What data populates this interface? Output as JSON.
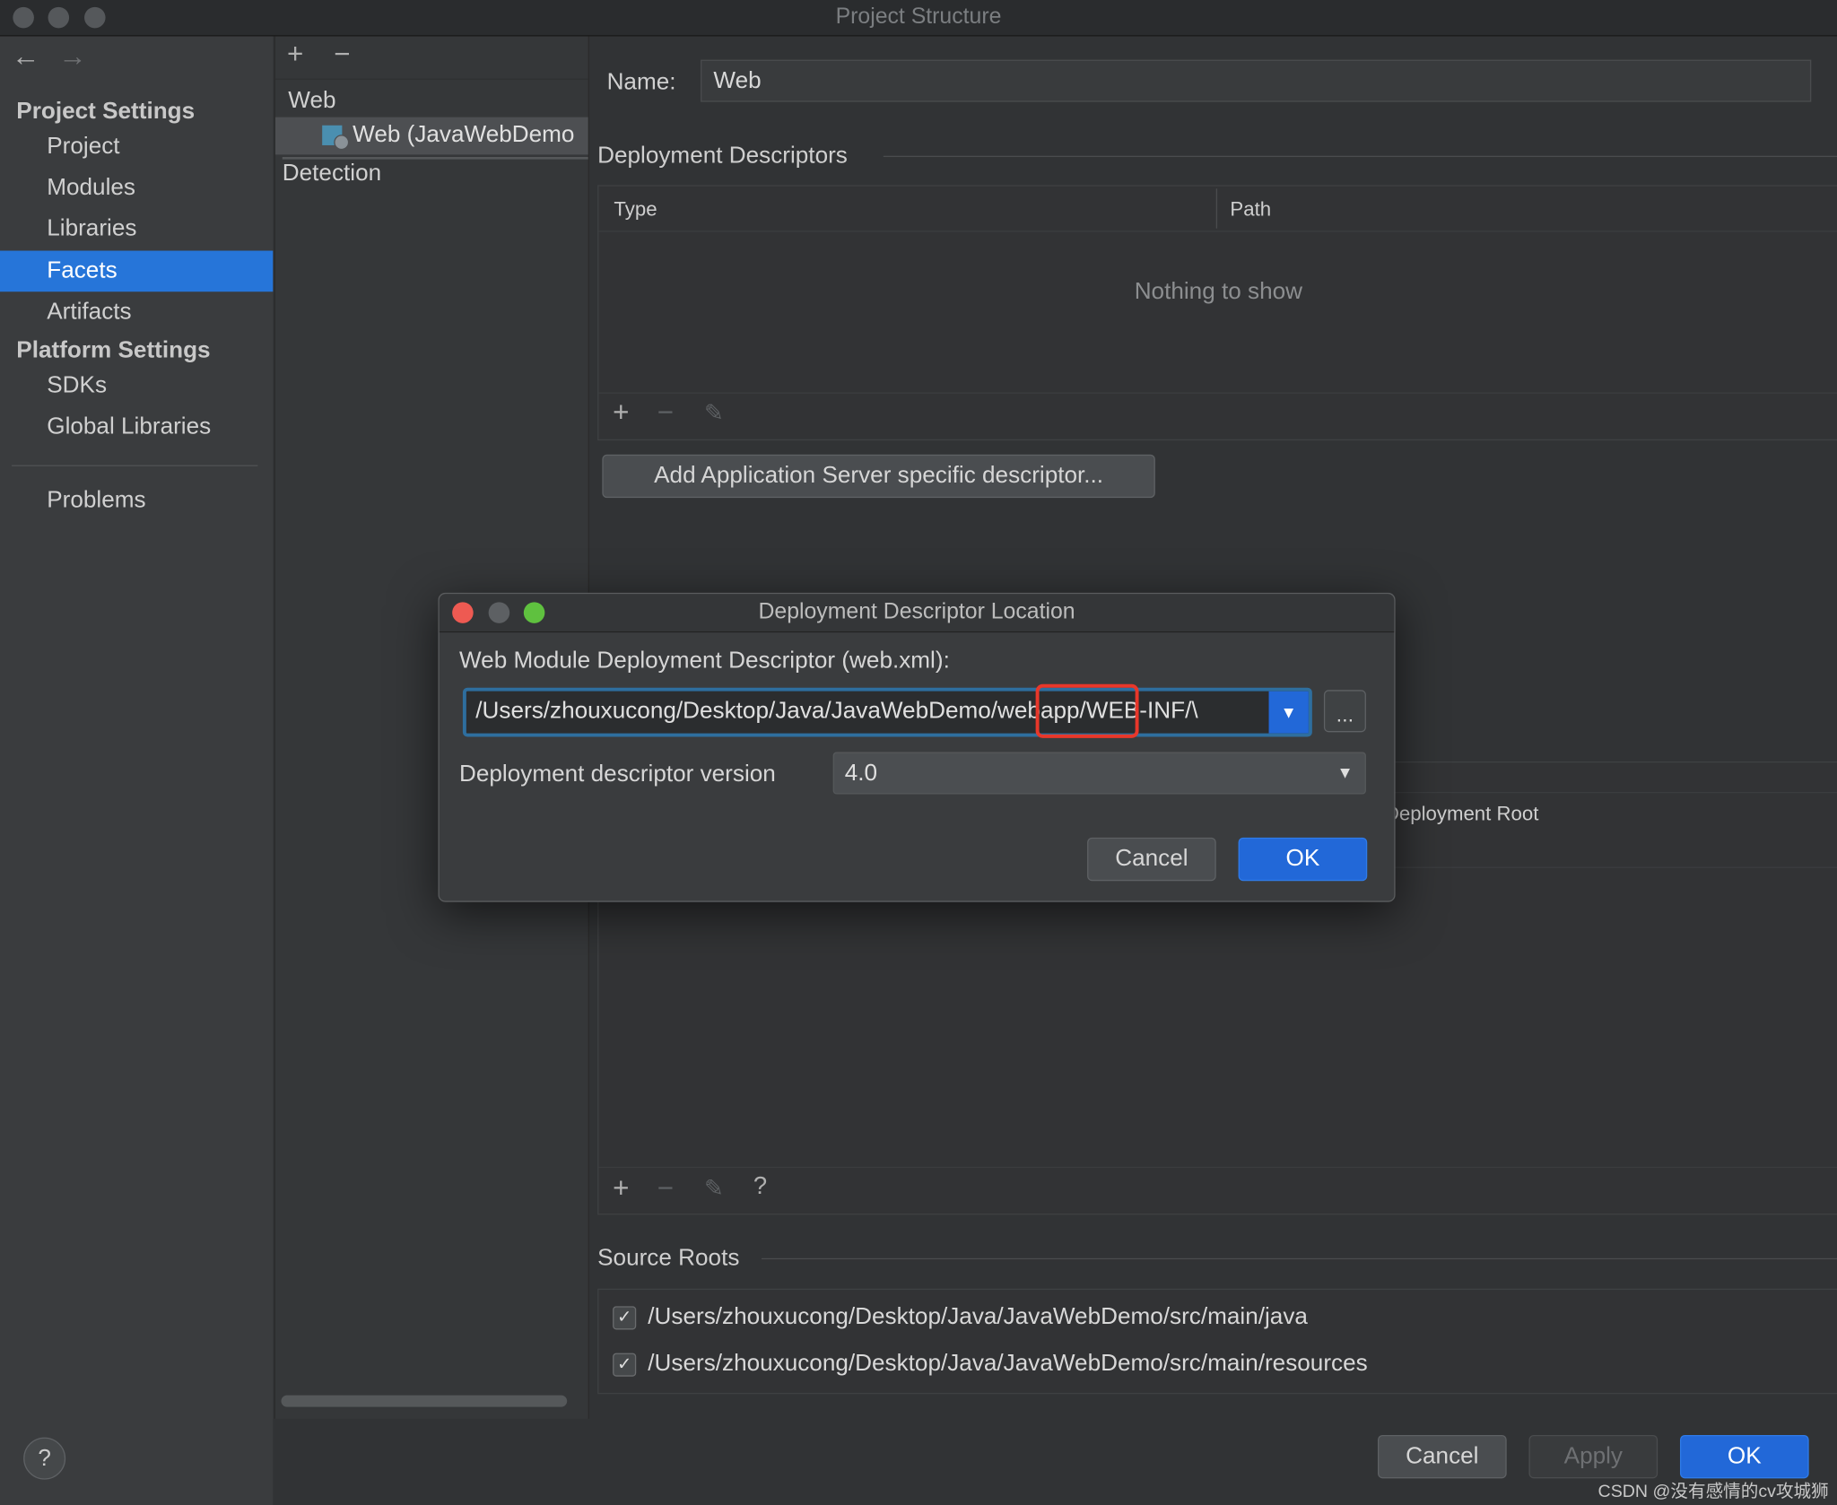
{
  "window": {
    "title": "Project Structure"
  },
  "sidebar": {
    "back_icon": "arrow-left",
    "forward_icon": "arrow-right",
    "project_settings": "Project Settings",
    "items": [
      {
        "label": "Project"
      },
      {
        "label": "Modules"
      },
      {
        "label": "Libraries"
      },
      {
        "label": "Facets",
        "selected": true
      },
      {
        "label": "Artifacts"
      }
    ],
    "platform_settings": "Platform Settings",
    "platform_items": [
      {
        "label": "SDKs"
      },
      {
        "label": "Global Libraries"
      }
    ],
    "problems": "Problems"
  },
  "facets": {
    "add": "+",
    "remove": "−",
    "group": "Web",
    "item": "Web (JavaWebDemo",
    "detection": "Detection"
  },
  "main": {
    "name_label": "Name:",
    "name_value": "Web",
    "deployment_descriptors": "Deployment Descriptors",
    "columns": [
      "Type",
      "Path"
    ],
    "empty": "Nothing to show",
    "add_server_descriptor": "Add Application Server specific descriptor...",
    "deployment_root_header": "Deployment Root",
    "help": "?",
    "source_roots": "Source Roots",
    "source_root_items": [
      {
        "path": "/Users/zhouxucong/Desktop/Java/JavaWebDemo/src/main/java",
        "checked": true
      },
      {
        "path": "/Users/zhouxucong/Desktop/Java/JavaWebDemo/src/main/resources",
        "checked": true
      }
    ]
  },
  "dialog": {
    "title": "Deployment Descriptor Location",
    "descriptor_label": "Web Module Deployment Descriptor (web.xml):",
    "path_before": "/Users/zhouxucong/Desktop/Java/JavaWebDemo",
    "path_highlight": "/webapp",
    "path_after": "/WEB-INF/\\",
    "browse": "...",
    "version_label": "Deployment descriptor version",
    "version_value": "4.0",
    "cancel": "Cancel",
    "ok": "OK",
    "highlight_color": "#e8372a"
  },
  "footer": {
    "help": "?",
    "cancel": "Cancel",
    "apply": "Apply",
    "ok": "OK"
  },
  "watermark": "CSDN @没有感情的cv攻城狮",
  "colors": {
    "accent": "#2675d9"
  }
}
